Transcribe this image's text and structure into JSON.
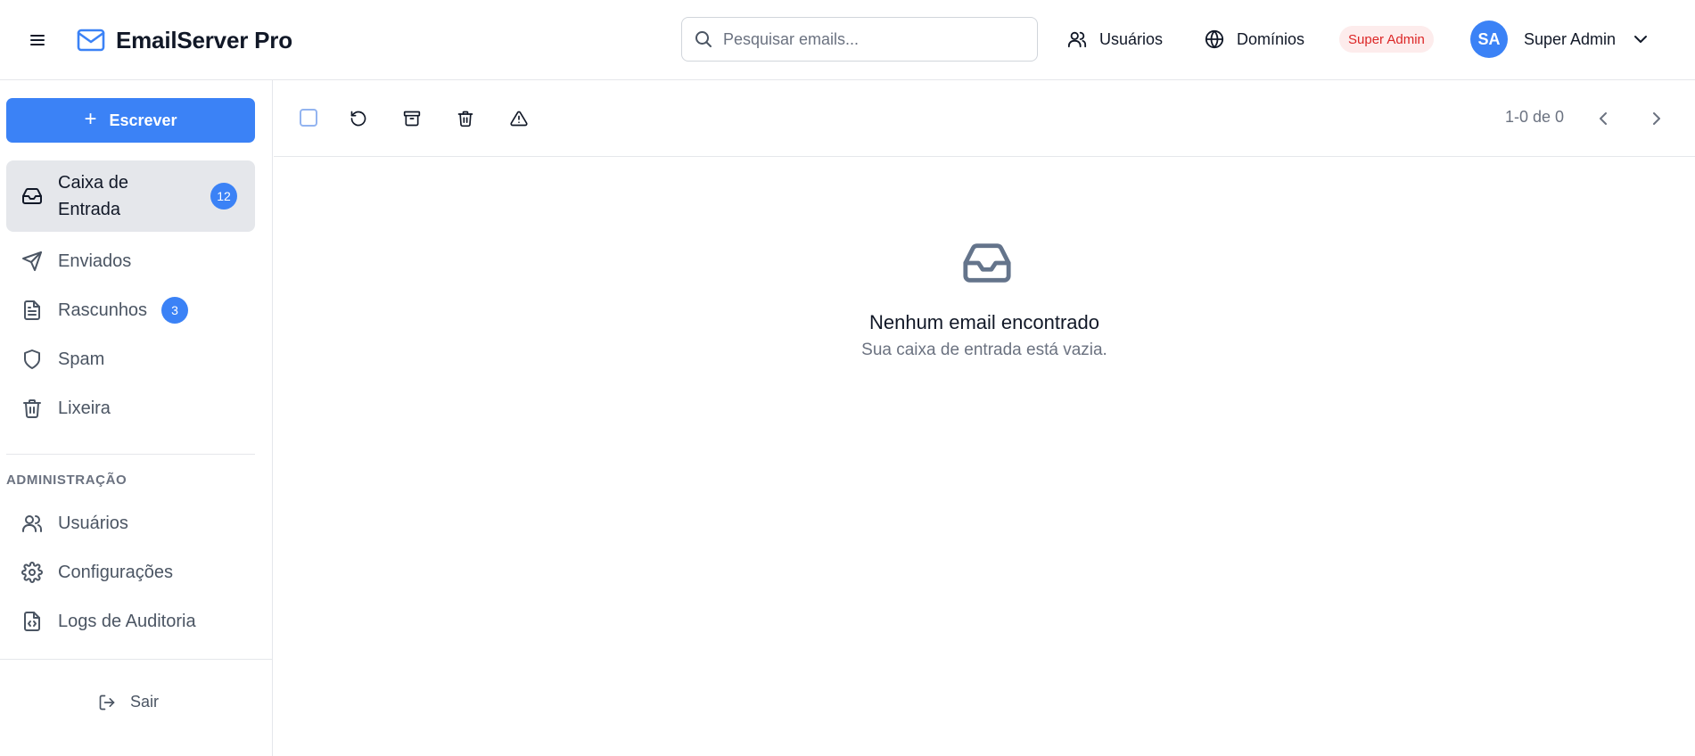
{
  "header": {
    "app_title": "EmailServer Pro",
    "search_placeholder": "Pesquisar emails...",
    "nav_users": "Usuários",
    "nav_domains": "Domínios",
    "role_badge": "Super Admin",
    "avatar_initials": "SA",
    "user_name": "Super Admin"
  },
  "sidebar": {
    "compose_label": "Escrever",
    "items": [
      {
        "label": "Caixa de Entrada",
        "count": "12",
        "icon": "inbox-icon",
        "active": true
      },
      {
        "label": "Enviados",
        "icon": "send-icon"
      },
      {
        "label": "Rascunhos",
        "count": "3",
        "icon": "file-text-icon"
      },
      {
        "label": "Spam",
        "icon": "shield-icon"
      },
      {
        "label": "Lixeira",
        "icon": "trash-icon"
      }
    ],
    "admin_section_title": "ADMINISTRAÇÃO",
    "admin_items": [
      {
        "label": "Usuários",
        "icon": "users-icon"
      },
      {
        "label": "Configurações",
        "icon": "gear-icon"
      },
      {
        "label": "Logs de Auditoria",
        "icon": "file-code-icon"
      }
    ],
    "logout_label": "Sair"
  },
  "toolbar": {
    "page_info": "1-0 de 0"
  },
  "empty_state": {
    "title": "Nenhum email encontrado",
    "subtitle": "Sua caixa de entrada está vazia."
  },
  "colors": {
    "accent": "#3b82f6",
    "active_bg": "#e5e7eb",
    "badge_bg": "#fdecec",
    "badge_text": "#dc2626",
    "muted_text": "#6b7280"
  }
}
